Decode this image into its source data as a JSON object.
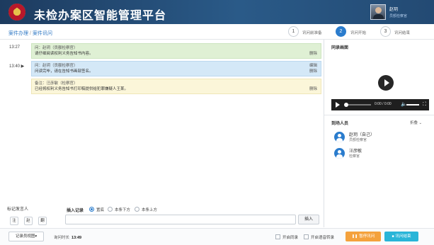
{
  "header": {
    "app_title": "未检办案区智能管理平台",
    "user_name": "赵玥",
    "user_role": "员额检察官"
  },
  "breadcrumb": {
    "root": "案件办理",
    "separator": "/",
    "current": "案件讯问"
  },
  "steps": [
    {
      "num": "1",
      "label": "讯问前准备",
      "active": false
    },
    {
      "num": "2",
      "label": "讯问开始",
      "active": true
    },
    {
      "num": "3",
      "label": "讯问结束",
      "active": false
    }
  ],
  "transcript": [
    {
      "time": "13:27",
      "speaker_line": "问：赵玥（员额检察官）",
      "content": "请仔细阅读权利义务告知书内容。",
      "actions": [
        "删除"
      ],
      "style": "green"
    },
    {
      "time": "13:40 ▶",
      "speaker_line": "问：赵玥（员额检察官）",
      "content": "问读完毕，请在告知书画部签名。",
      "actions": [
        "编辑",
        "删除"
      ],
      "style": "blue"
    },
    {
      "time": "",
      "speaker_line": "备注：汪彦敏（检察官）",
      "content": "已经将权利义务告知书打印稿提供给犯罪嫌疑人王某。",
      "actions": [
        "删除"
      ],
      "style": "yellow"
    }
  ],
  "recording": {
    "title": "同录画面",
    "time_display": "0:00 / 0:00"
  },
  "attendees": {
    "title": "到场人员",
    "collapse_label": "折叠 ⌄",
    "people": [
      {
        "name": "赵玥（自己）",
        "role": "员额检察官"
      },
      {
        "name": "汪彦敏",
        "role": "检察官"
      }
    ]
  },
  "speaker": {
    "label": "标记发言人",
    "buttons": [
      "注",
      "赵",
      "翻"
    ]
  },
  "insert": {
    "label": "插入记录",
    "options": [
      {
        "label": "置底",
        "selected": true
      },
      {
        "label": "本条下方",
        "selected": false
      },
      {
        "label": "本条上方",
        "selected": false
      }
    ],
    "input_value": "",
    "button_label": "插入"
  },
  "footer": {
    "view_button": "记录员视图▾",
    "duration_label": "询问时长",
    "duration_value": "13:49",
    "checkbox_sync": "开启同录",
    "checkbox_voice": "开启语音转录",
    "pause_button": "暂停讯问",
    "end_button": "讯问结束"
  },
  "colors": {
    "header_bg": "#1d3b5f",
    "accent": "#2a7ccd",
    "pause": "#f4a23c",
    "end": "#29b5d8"
  }
}
